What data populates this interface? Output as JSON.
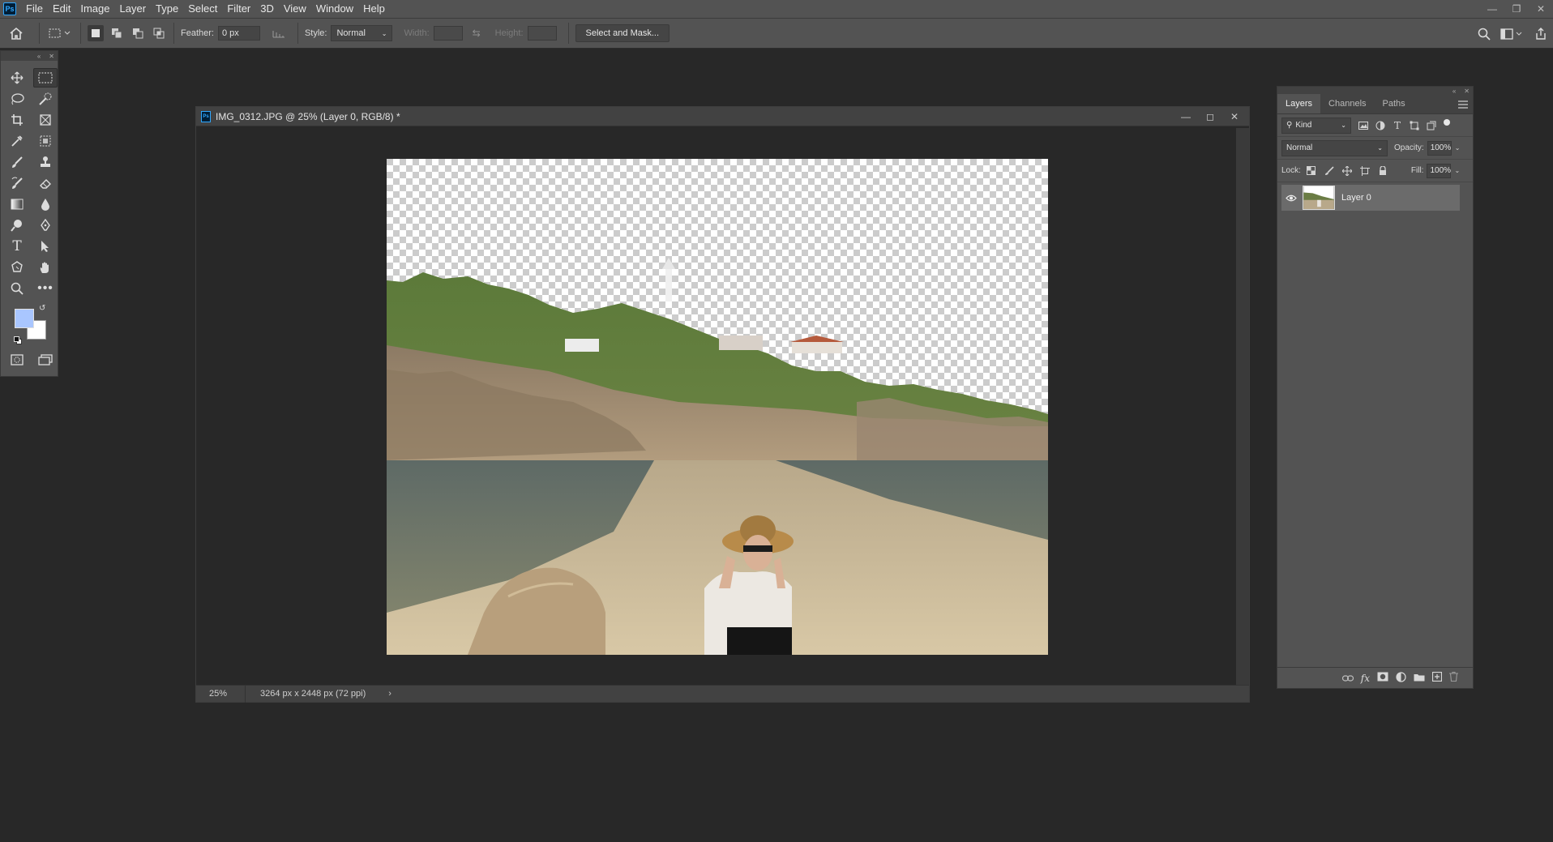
{
  "menubar": {
    "logo": "Ps",
    "items": [
      "File",
      "Edit",
      "Image",
      "Layer",
      "Type",
      "Select",
      "Filter",
      "3D",
      "View",
      "Window",
      "Help"
    ]
  },
  "options": {
    "feather_label": "Feather:",
    "feather_value": "0 px",
    "style_label": "Style:",
    "style_value": "Normal",
    "width_label": "Width:",
    "height_label": "Height:",
    "select_mask_label": "Select and Mask..."
  },
  "document": {
    "title": "IMG_0312.JPG @ 25% (Layer 0, RGB/8) *",
    "zoom": "25%",
    "info": "3264 px x 2448 px (72 ppi)"
  },
  "layers_panel": {
    "tabs": [
      "Layers",
      "Channels",
      "Paths"
    ],
    "filter_kind": "Kind",
    "blend_mode": "Normal",
    "opacity_label": "Opacity:",
    "opacity_value": "100%",
    "lock_label": "Lock:",
    "fill_label": "Fill:",
    "fill_value": "100%",
    "layers": [
      {
        "name": "Layer 0",
        "visible": true
      }
    ]
  },
  "colors": {
    "foreground": "#a9c6ff",
    "background": "#ffffff",
    "ps_accent": "#31a8ff"
  }
}
